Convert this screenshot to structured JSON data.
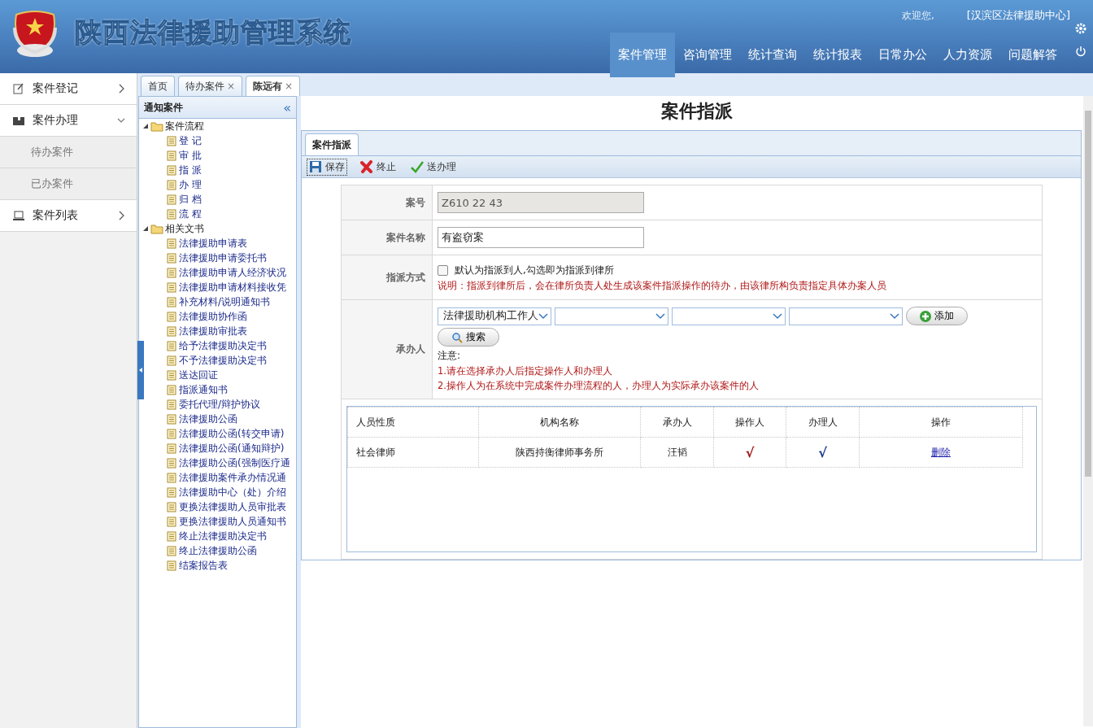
{
  "header": {
    "title": "陕西法律援助管理系统",
    "welcome": "欢迎您,",
    "org": "[汉滨区法律援助中心]"
  },
  "nav": [
    {
      "label": "案件管理",
      "selected": true
    },
    {
      "label": "咨询管理",
      "selected": false
    },
    {
      "label": "统计查询",
      "selected": false
    },
    {
      "label": "统计报表",
      "selected": false
    },
    {
      "label": "日常办公",
      "selected": false
    },
    {
      "label": "人力资源",
      "selected": false
    },
    {
      "label": "问题解答",
      "selected": false
    }
  ],
  "sidebar": {
    "items": [
      {
        "label": "案件登记",
        "kind": "edit",
        "expanded": false
      },
      {
        "label": "案件办理",
        "kind": "box",
        "expanded": true,
        "children": [
          {
            "label": "待办案件"
          },
          {
            "label": "已办案件"
          }
        ]
      },
      {
        "label": "案件列表",
        "kind": "laptop",
        "expanded": false
      }
    ]
  },
  "tabs": [
    {
      "label": "首页",
      "selected": false
    },
    {
      "label": "待办案件",
      "selected": false,
      "close": "×"
    },
    {
      "label": "陈远有",
      "selected": true,
      "close": "×"
    }
  ],
  "tree": {
    "title": "通知案件",
    "collapse": "«",
    "nodes": [
      {
        "label": "案件流程",
        "expanded": true,
        "children": [
          {
            "label": "登 记"
          },
          {
            "label": "审 批"
          },
          {
            "label": "指 派"
          },
          {
            "label": "办 理"
          },
          {
            "label": "归 档"
          },
          {
            "label": "流 程"
          }
        ]
      },
      {
        "label": "相关文书",
        "expanded": true,
        "children": [
          {
            "label": "法律援助申请表"
          },
          {
            "label": "法律援助申请委托书"
          },
          {
            "label": "法律援助申请人经济状况"
          },
          {
            "label": "法律援助申请材料接收凭"
          },
          {
            "label": "补充材料/说明通知书"
          },
          {
            "label": "法律援助协作函"
          },
          {
            "label": "法律援助审批表"
          },
          {
            "label": "给予法律援助决定书"
          },
          {
            "label": "不予法律援助决定书"
          },
          {
            "label": "送达回证"
          },
          {
            "label": "指派通知书"
          },
          {
            "label": "委托代理/辩护协议"
          },
          {
            "label": "法律援助公函"
          },
          {
            "label": "法律援助公函(转交申请)"
          },
          {
            "label": "法律援助公函(通知辩护)"
          },
          {
            "label": "法律援助公函(强制医疗通"
          },
          {
            "label": "法律援助案件承办情况通"
          },
          {
            "label": "法律援助中心（处）介绍"
          },
          {
            "label": "更换法律援助人员审批表"
          },
          {
            "label": "更换法律援助人员通知书"
          },
          {
            "label": "终止法律援助决定书"
          },
          {
            "label": "终止法律援助公函"
          },
          {
            "label": "结案报告表"
          }
        ]
      }
    ]
  },
  "page": {
    "title": "案件指派",
    "panel_tab": "案件指派",
    "toolbar": [
      {
        "label": "保存",
        "kind": "save"
      },
      {
        "label": "终止",
        "kind": "stop"
      },
      {
        "label": "送办理",
        "kind": "send"
      }
    ],
    "form": {
      "case_number": {
        "label": "案号",
        "value": "Z610 22 43",
        "disabled": true
      },
      "case_name": {
        "label": "案件名称",
        "value": "有盗窃案"
      },
      "assign_mode": {
        "label": "指派方式",
        "checkbox_label": "默认为指派到人,勾选即为指派到律所",
        "checked": false,
        "note": "说明：指派到律所后，会在律所负责人处生成该案件指派操作的待办，由该律所构负责指定具体办案人员"
      },
      "handler": {
        "label": "承办人",
        "selects": [
          {
            "kind": "dropdown",
            "value": "法律援助机构工作人"
          },
          {
            "kind": "dropdown"
          },
          {
            "kind": "dropdown"
          },
          {
            "kind": "dropdown"
          }
        ],
        "add": "添加",
        "search": "搜索",
        "notes": [
          "注意:",
          "1.请在选择承办人后指定操作人和办理人",
          "2.操作人为在系统中完成案件办理流程的人，办理人为实际承办该案件的人"
        ]
      }
    },
    "table": {
      "columns": [
        "人员性质",
        "机构名称",
        "承办人",
        "操作人",
        "办理人",
        "操作"
      ],
      "rows": [
        {
          "type": "社会律师",
          "org": "陕西持衡律师事务所",
          "handler": "汪韬",
          "operator_mark": {
            "text": "√",
            "color": "#a01818"
          },
          "processor_mark": {
            "text": "√",
            "color": "#1a3a8a"
          },
          "action": "删除"
        }
      ]
    }
  }
}
